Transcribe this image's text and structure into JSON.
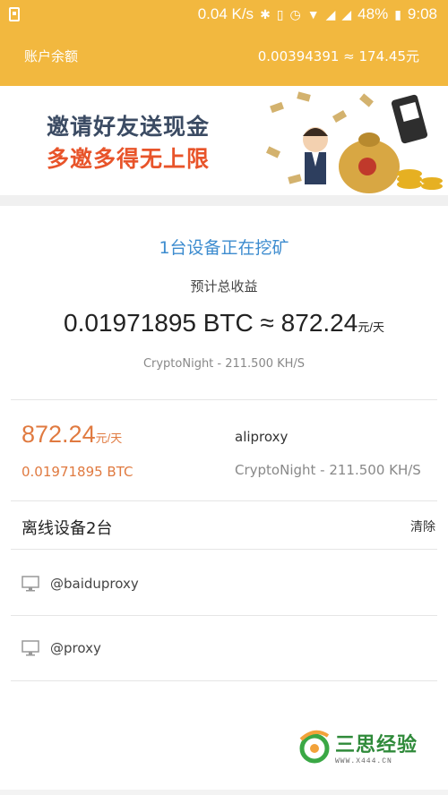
{
  "status_bar": {
    "network_speed": "0.04 K/s",
    "battery": "48%",
    "time": "9:08",
    "icons": [
      "notification-icon",
      "bluetooth-icon",
      "vibrate-icon",
      "alarm-icon",
      "wifi-icon",
      "signal-icon",
      "battery-icon"
    ]
  },
  "header": {
    "title": "账户余额",
    "balance": "0.00394391 ≈ 174.45元"
  },
  "banner": {
    "line1": "邀请好友送现金",
    "line2": "多邀多得无上限"
  },
  "mining": {
    "title": "1台设备正在挖矿",
    "estimate_label": "预计总收益",
    "estimate_btc": "0.01971895 BTC ≈ 872.24",
    "estimate_unit": "元/天",
    "algo_hashrate": "CryptoNight - 211.500 KH/S"
  },
  "active_device": {
    "rate": "872.24",
    "rate_unit": "元/天",
    "btc": "0.01971895 BTC",
    "name": "aliproxy",
    "algo_hashrate": "CryptoNight - 211.500 KH/S"
  },
  "offline": {
    "title": "离线设备2台",
    "clear_label": "清除",
    "devices": [
      {
        "name": "@baiduproxy"
      },
      {
        "name": "@proxy"
      }
    ]
  },
  "watermark": {
    "text": "三思经验",
    "sub": "WWW.X444.CN"
  },
  "colors": {
    "accent": "#f2b83f",
    "mining_title": "#3d8ccf",
    "earning": "#e07a40"
  }
}
